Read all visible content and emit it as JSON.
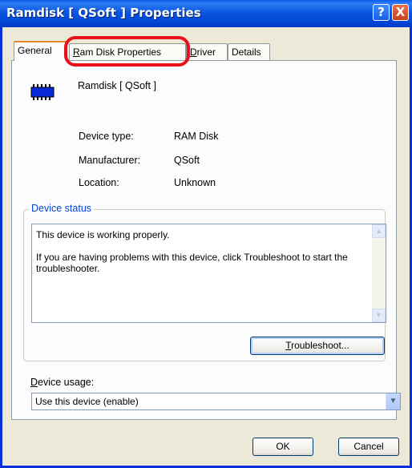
{
  "window": {
    "title": "Ramdisk [ QSoft ] Properties",
    "help_label": "?",
    "close_label": "X"
  },
  "tabs": [
    {
      "label": "General",
      "active": true
    },
    {
      "label_pre": "",
      "label_mnemonic": "R",
      "label_post": "am Disk Properties",
      "active": false
    },
    {
      "label_pre": "",
      "label_mnemonic": "D",
      "label_post": "river",
      "active": false
    },
    {
      "label": "Details",
      "active": false
    }
  ],
  "device": {
    "icon": "ram-chip-icon",
    "name": "Ramdisk [ QSoft ]",
    "type_label": "Device type:",
    "type_value": "RAM Disk",
    "manufacturer_label": "Manufacturer:",
    "manufacturer_value": "QSoft",
    "location_label": "Location:",
    "location_value": "Unknown"
  },
  "status": {
    "group_title": "Device status",
    "line1": "This device is working properly.",
    "line2": "If you are having problems with this device, click Troubleshoot to start the troubleshooter.",
    "troubleshoot_mnemonic": "T",
    "troubleshoot_rest": "roubleshoot..."
  },
  "usage": {
    "label_mnemonic": "D",
    "label_rest": "evice usage:",
    "selected": "Use this device (enable)"
  },
  "footer": {
    "ok_label": "OK",
    "cancel_label": "Cancel"
  },
  "colors": {
    "title_bar": "#0a56e0",
    "highlight_ring": "#e8101a",
    "group_title": "#0046d5"
  }
}
